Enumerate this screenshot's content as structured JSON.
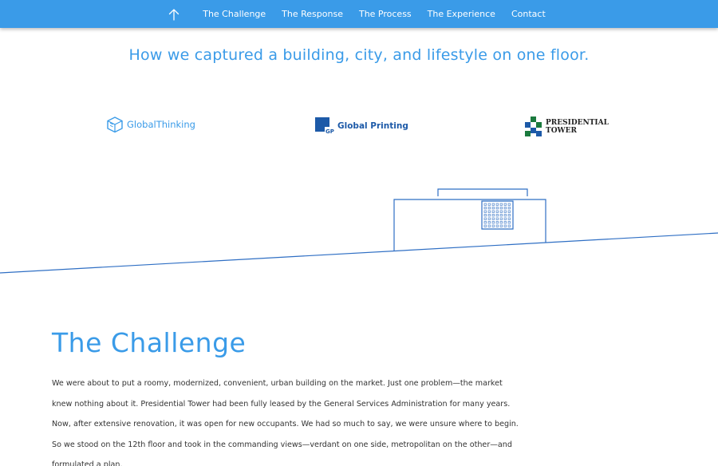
{
  "nav": {
    "up_icon": "arrow-up-icon",
    "links": [
      "The Challenge",
      "The Response",
      "The Process",
      "The Experience",
      "Contact"
    ]
  },
  "tagline": "How we captured a building, city, and lifestyle on one floor.",
  "logos": {
    "global_thinking": {
      "part1": "Global",
      "part2": "Thinking"
    },
    "global_printing": {
      "text": "Global Printing"
    },
    "presidential_tower": {
      "line1": "PRESIDENTIAL",
      "line2": "TOWER"
    }
  },
  "challenge": {
    "title": "The Challenge",
    "body": "We were about to put a roomy, modernized, convenient, urban building on the market. Just one problem—the market knew nothing about it. Presidential Tower had been fully leased by the General Services Administration for many years. Now, after extensive renovation, it was open for new occupants. We had so much to say, we were unsure where to begin. So we stood on the 12th floor and took in the commanding views—verdant on one side, metropolitan on the other—and formulated a plan."
  },
  "colors": {
    "accent": "#3a9be8",
    "line": "#2f6fc4",
    "nav_bg": "#3a9be8"
  }
}
